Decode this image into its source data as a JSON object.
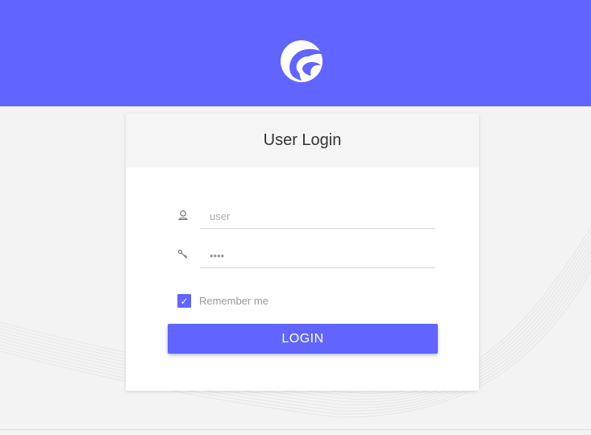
{
  "brand": {
    "logo_icon": "wave-logo-icon",
    "primary_color": "#6164ff"
  },
  "login": {
    "title": "User Login",
    "username": {
      "placeholder": "user",
      "value": "",
      "icon": "user-icon"
    },
    "password": {
      "value": "••••",
      "icon": "key-icon"
    },
    "remember": {
      "label": "Remember me",
      "checked": true
    },
    "submit_label": "LOGIN"
  }
}
